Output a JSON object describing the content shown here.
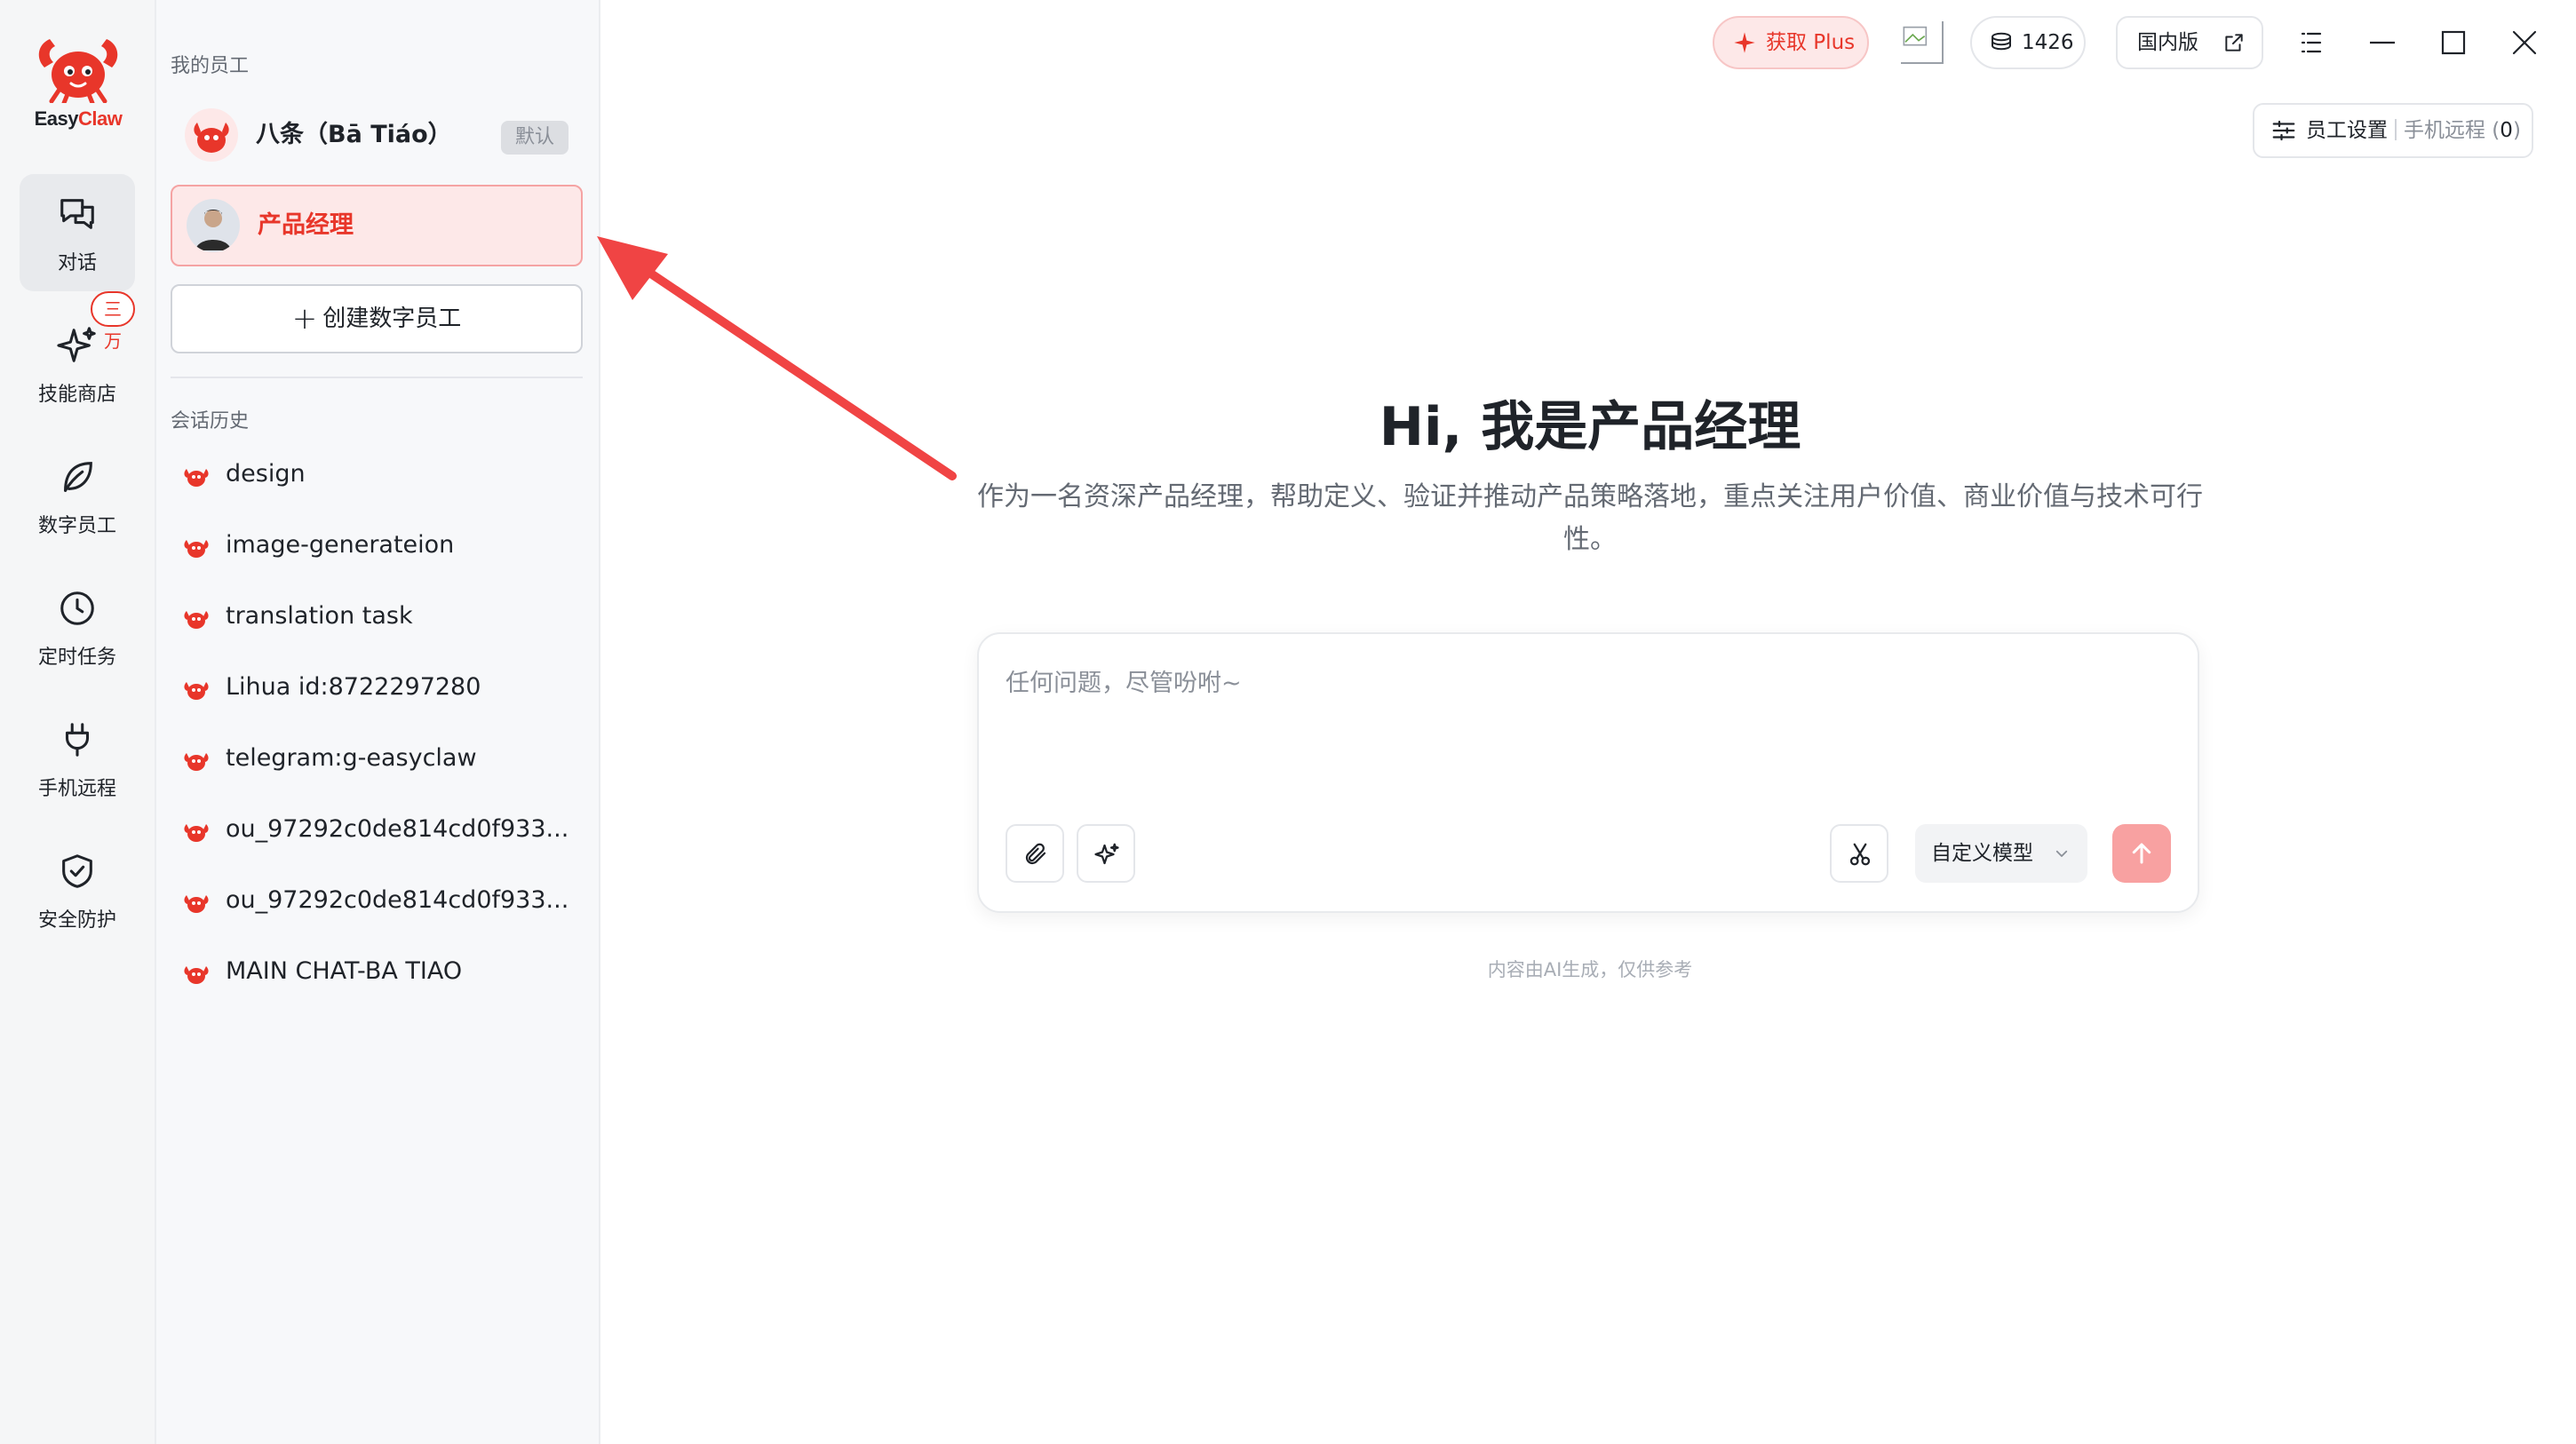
{
  "app": {
    "logo_text_1": "Easy",
    "logo_text_2": "Claw",
    "brand_color": "#e8362a"
  },
  "nav": [
    {
      "label": "对话",
      "icon": "chat-bubbles-icon",
      "active": true
    },
    {
      "label": "技能商店",
      "icon": "sparkle-icon",
      "badge": "三万"
    },
    {
      "label": "数字员工",
      "icon": "leaf-icon"
    },
    {
      "label": "定时任务",
      "icon": "clock-icon"
    },
    {
      "label": "手机远程",
      "icon": "plug-icon"
    },
    {
      "label": "安全防护",
      "icon": "shield-check-icon"
    }
  ],
  "sidebar": {
    "employees_title": "我的员工",
    "employees": [
      {
        "name": "八条（Bā Tiáo）",
        "tag": "默认",
        "selected": false
      },
      {
        "name": "产品经理",
        "selected": true
      }
    ],
    "create_label": "创建数字员工",
    "history_title": "会话历史",
    "history": [
      "design",
      "image-generateion",
      "translation task",
      "Lihua id:8722297280",
      "telegram:g-easyclaw",
      "ou_97292c0de814cd0f933...",
      "ou_97292c0de814cd0f933...",
      "MAIN CHAT-BA TIAO"
    ]
  },
  "topbar": {
    "plus_label": "获取 Plus",
    "credits": "1426",
    "region_label": "国内版",
    "settings_label": "员工设置",
    "remote_label": "手机远程",
    "remote_count": "0"
  },
  "main": {
    "title": "Hi, 我是产品经理",
    "description": "作为一名资深产品经理，帮助定义、验证并推动产品策略落地，重点关注用户价值、商业价值与技术可行性。",
    "input_placeholder": "任何问题，尽管吩咐~",
    "model_label": "自定义模型",
    "disclaimer": "内容由AI生成，仅供参考"
  }
}
